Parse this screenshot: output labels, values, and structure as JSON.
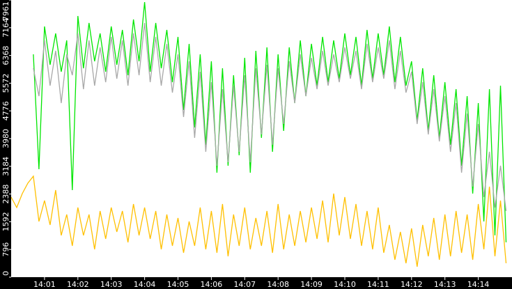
{
  "chart_data": {
    "type": "line",
    "title": "",
    "xlabel": "",
    "ylabel": "",
    "x_start": "14:00:00",
    "x_step_seconds": 10,
    "xlim_minutes": [
      0,
      15
    ],
    "ylim": [
      0,
      7961
    ],
    "grid": false,
    "y_ticks": [
      "0",
      "796",
      "1592",
      "2388",
      "3184",
      "3980",
      "4776",
      "5572",
      "6368",
      "7164",
      "7961"
    ],
    "y_tick_values": [
      0,
      796,
      1592,
      2388,
      3184,
      3980,
      4776,
      5572,
      6368,
      7164,
      7961
    ],
    "x_ticks": [
      "14:01",
      "14:02",
      "14:03",
      "14:04",
      "14:05",
      "14:06",
      "14:07",
      "14:08",
      "14:09",
      "14:10",
      "14:11",
      "14:12",
      "14:13",
      "14:14"
    ],
    "x_tick_minutes": [
      1,
      2,
      3,
      4,
      5,
      6,
      7,
      8,
      9,
      10,
      11,
      12,
      13,
      14
    ],
    "series": [
      {
        "name": "green",
        "color": "#00e600",
        "values": [
          null,
          null,
          null,
          null,
          6400,
          3100,
          7200,
          6100,
          7000,
          5900,
          6800,
          2500,
          7500,
          6000,
          7300,
          6200,
          7000,
          5900,
          7200,
          6100,
          7100,
          5800,
          7400,
          6200,
          7900,
          5900,
          7300,
          6000,
          7100,
          5600,
          6900,
          4800,
          6700,
          4300,
          6400,
          3800,
          6200,
          3000,
          6000,
          3200,
          5800,
          3500,
          6300,
          3000,
          6500,
          4000,
          6600,
          3600,
          6400,
          4200,
          6600,
          5000,
          6800,
          5200,
          6700,
          5500,
          6900,
          5600,
          6800,
          5700,
          7000,
          5800,
          6900,
          5500,
          7100,
          5700,
          7000,
          5800,
          7200,
          5600,
          6900,
          5500,
          6200,
          4500,
          6000,
          4200,
          5800,
          4000,
          5600,
          3800,
          5400,
          3200,
          5200,
          2400,
          5000,
          1600,
          5400,
          1200,
          5500,
          1000
        ]
      },
      {
        "name": "gray",
        "color": "#a8a8a8",
        "values": [
          null,
          null,
          null,
          null,
          6000,
          5200,
          6800,
          5500,
          6500,
          5000,
          6400,
          5800,
          7000,
          5400,
          6800,
          5500,
          6600,
          5600,
          6900,
          5700,
          6800,
          5500,
          7000,
          5800,
          7300,
          5600,
          6900,
          5500,
          6700,
          5300,
          6400,
          4600,
          6200,
          4000,
          5900,
          3600,
          5600,
          3200,
          5400,
          3300,
          5500,
          3600,
          5800,
          3300,
          6000,
          4100,
          6100,
          3800,
          6000,
          4400,
          6200,
          5000,
          6400,
          5200,
          6300,
          5400,
          6500,
          5500,
          6400,
          5600,
          6600,
          5700,
          6500,
          5400,
          6700,
          5600,
          6600,
          5700,
          6800,
          5400,
          6500,
          5300,
          5900,
          4400,
          5600,
          4100,
          5400,
          3900,
          5200,
          3600,
          5000,
          3000,
          4700,
          2600,
          4400,
          2300,
          3600,
          2000,
          3200,
          1900
        ]
      },
      {
        "name": "yellow",
        "color": "#ffc000",
        "values": [
          2300,
          2000,
          2400,
          2700,
          2900,
          1600,
          2200,
          1500,
          2500,
          1200,
          1800,
          900,
          2000,
          1200,
          1800,
          800,
          1900,
          1100,
          2000,
          1300,
          1900,
          1000,
          2100,
          1200,
          2000,
          1100,
          1900,
          800,
          1800,
          900,
          1700,
          700,
          1600,
          900,
          2000,
          800,
          1900,
          700,
          2100,
          600,
          1800,
          900,
          2000,
          800,
          1700,
          900,
          1900,
          700,
          2100,
          800,
          1800,
          900,
          1900,
          1000,
          2000,
          1100,
          2200,
          1000,
          2400,
          1200,
          2300,
          1100,
          2100,
          900,
          1900,
          800,
          2000,
          700,
          1500,
          500,
          1300,
          400,
          1400,
          300,
          1500,
          600,
          1700,
          500,
          1800,
          600,
          1900,
          700,
          1800,
          500,
          2100,
          800,
          2600,
          600,
          2200,
          400
        ]
      }
    ]
  }
}
